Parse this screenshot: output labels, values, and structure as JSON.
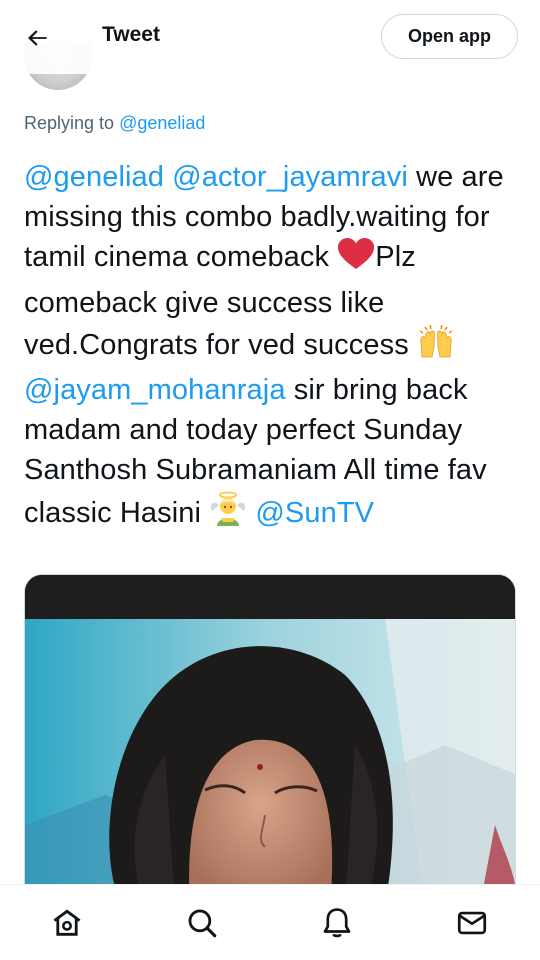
{
  "header": {
    "title": "Tweet",
    "open_app_label": "Open app"
  },
  "reply": {
    "prefix": "Replying to",
    "handle": "@geneliad"
  },
  "tweet": {
    "mention_1": "@geneliad",
    "mention_2": "@actor_jayamravi",
    "text_1": " we are missing this combo badly.waiting for tamil cinema comeback ",
    "text_2": "Plz comeback give success like ved.Congrats for ved success ",
    "mention_3": "@jayam_mohanraja",
    "text_3": " sir bring back madam and today perfect Sunday Santhosh Subramaniam All time fav classic Hasini ",
    "mention_4": "@SunTV"
  },
  "icons": {
    "back": "arrow-left-icon",
    "heart": "red-heart-emoji",
    "hands": "raising-hands-emoji",
    "angel": "angel-emoji",
    "home": "home-icon",
    "search": "search-icon",
    "notifications": "bell-icon",
    "messages": "mail-icon"
  },
  "colors": {
    "accent": "#1d9bf0",
    "text": "#0f1419",
    "secondary": "#536471"
  }
}
